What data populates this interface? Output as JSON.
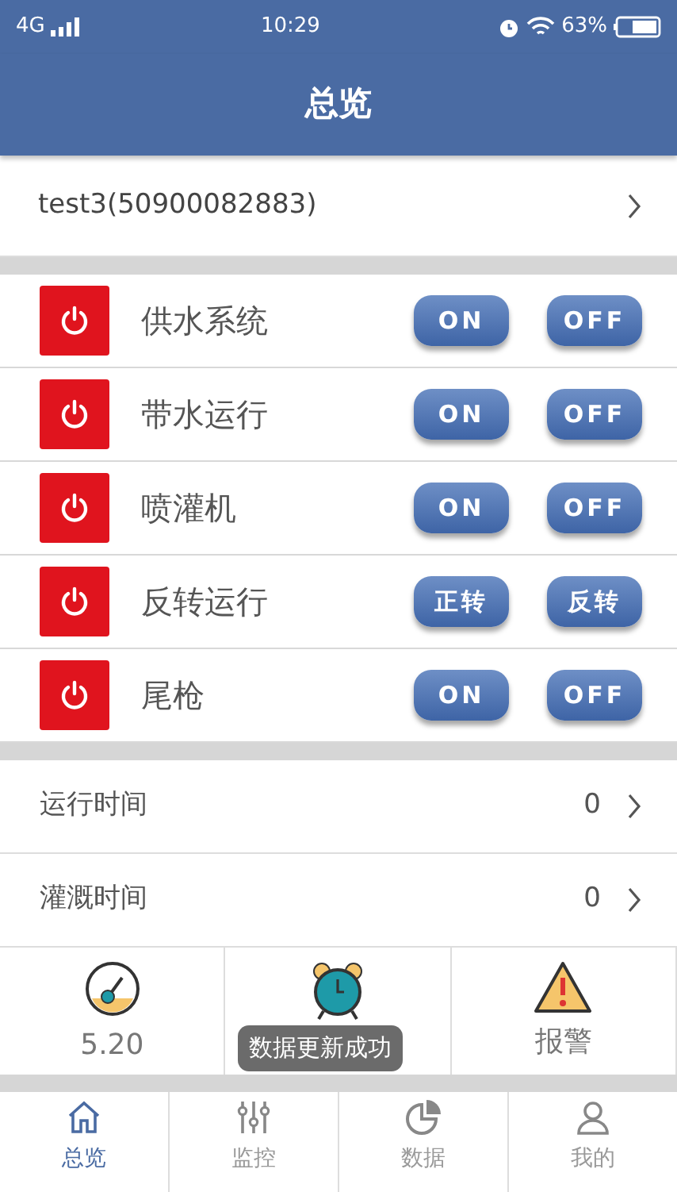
{
  "status_bar": {
    "network": "4G",
    "time": "10:29",
    "battery": "63%"
  },
  "header": {
    "title": "总览"
  },
  "device": {
    "name": "test3(50900082883)"
  },
  "controls": [
    {
      "name": "供水系统",
      "buttons": [
        "ON",
        "OFF"
      ]
    },
    {
      "name": "带水运行",
      "buttons": [
        "ON",
        "OFF"
      ]
    },
    {
      "name": "喷灌机",
      "buttons": [
        "ON",
        "OFF"
      ]
    },
    {
      "name": "反转运行",
      "buttons": [
        "正转",
        "反转"
      ]
    },
    {
      "name": "尾枪",
      "buttons": [
        "ON",
        "OFF"
      ]
    }
  ],
  "info_rows": [
    {
      "label": "运行时间",
      "value": "0"
    },
    {
      "label": "灌溉时间",
      "value": "0"
    }
  ],
  "tiles": [
    {
      "kind": "gauge",
      "label": "5.20"
    },
    {
      "kind": "alarm"
    },
    {
      "kind": "warning",
      "label": "报警"
    }
  ],
  "toast": "数据更新成功",
  "tabs": [
    {
      "kind": "home",
      "label": "总览",
      "selected": true
    },
    {
      "kind": "sliders",
      "label": "监控",
      "selected": false
    },
    {
      "kind": "pie",
      "label": "数据",
      "selected": false
    },
    {
      "kind": "user",
      "label": "我的",
      "selected": false
    }
  ]
}
